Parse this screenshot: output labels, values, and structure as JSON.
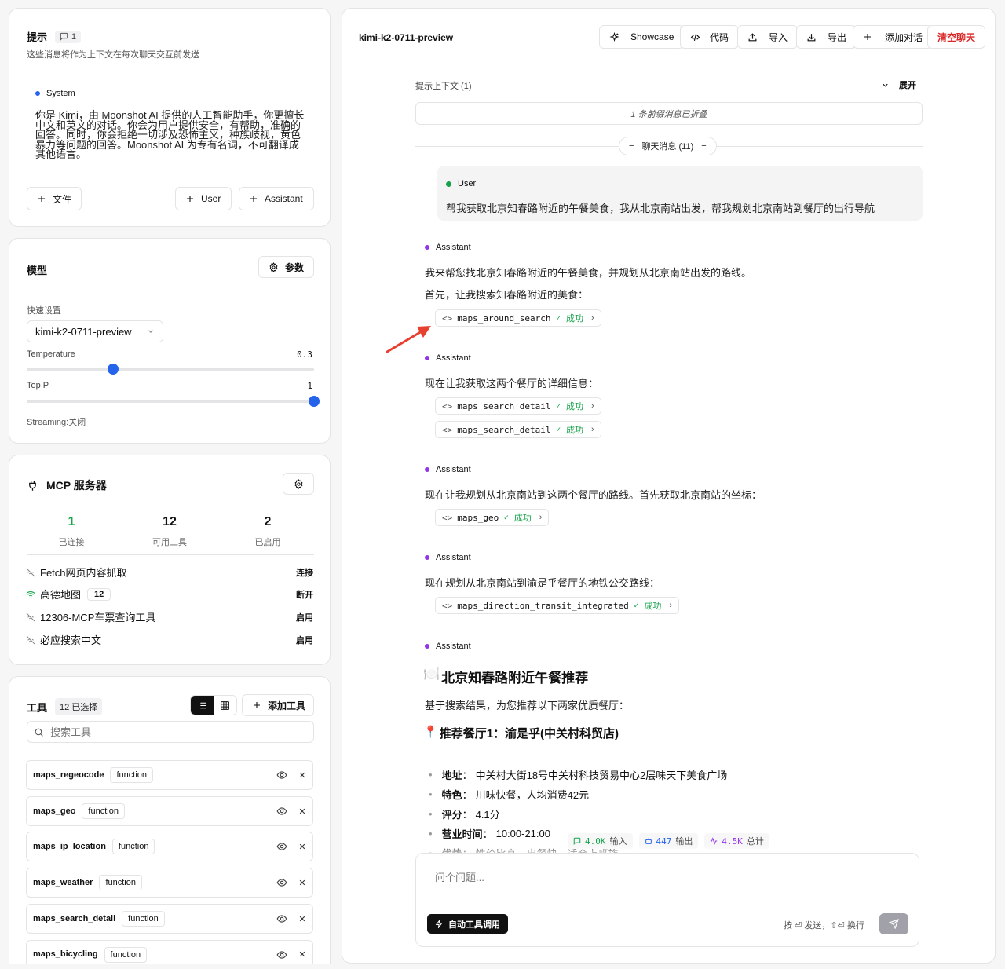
{
  "prompt": {
    "title": "提示",
    "count_badge": "1",
    "subtitle": "这些消息将作为上下文在每次聊天交互前发送",
    "system_role": "System",
    "system_text": "你是 Kimi，由 Moonshot AI 提供的人工智能助手，你更擅长中文和英文的对话。你会为用户提供安全，有帮助，准确的回答。同时，你会拒绝一切涉及恐怖主义，种族歧视，黄色暴力等问题的回答。Moonshot AI 为专有名词，不可翻译成其他语言。",
    "file_btn": "文件",
    "user_btn": "User",
    "assistant_btn": "Assistant"
  },
  "model": {
    "title": "模型",
    "params_btn": "参数",
    "quick_label": "快速设置",
    "model_value": "kimi-k2-0711-preview",
    "temperature_label": "Temperature",
    "temperature_value": "0.3",
    "temperature_fraction": 0.3,
    "topp_label": "Top P",
    "topp_value": "1",
    "topp_fraction": 1.0,
    "streaming": "Streaming:关闭"
  },
  "mcp": {
    "title": "MCP 服务器",
    "stats": [
      {
        "value": "1",
        "label": "已连接"
      },
      {
        "value": "12",
        "label": "可用工具"
      },
      {
        "value": "2",
        "label": "已启用"
      }
    ],
    "servers": [
      {
        "name": "Fetch网页内容抓取",
        "action": "连接",
        "badge": ""
      },
      {
        "name": "高德地图",
        "action": "断开",
        "badge": "12"
      },
      {
        "name": "12306-MCP车票查询工具",
        "action": "启用",
        "badge": ""
      },
      {
        "name": "必应搜索中文",
        "action": "启用",
        "badge": ""
      }
    ]
  },
  "tools": {
    "title": "工具",
    "selected_badge": "12 已选择",
    "add_btn": "添加工具",
    "search_placeholder": "搜索工具",
    "items": [
      {
        "name": "maps_regeocode",
        "type": "function"
      },
      {
        "name": "maps_geo",
        "type": "function"
      },
      {
        "name": "maps_ip_location",
        "type": "function"
      },
      {
        "name": "maps_weather",
        "type": "function"
      },
      {
        "name": "maps_search_detail",
        "type": "function"
      },
      {
        "name": "maps_bicycling",
        "type": "function"
      }
    ]
  },
  "chat": {
    "title": "kimi-k2-0711-preview",
    "toolbar": {
      "showcase": "Showcase",
      "code": "代码",
      "import": "导入",
      "export": "导出",
      "add_chat": "添加对话",
      "clear": "清空聊天"
    },
    "context_label": "提示上下文 (1)",
    "expand": "展开",
    "collapsed_note": "1 条前缀消息已折叠",
    "messages_pill": "聊天消息 (11)",
    "user_role": "User",
    "user_text": "帮我获取北京知春路附近的午餐美食，我从北京南站出发，帮我规划北京南站到餐厅的出行导航",
    "assistant_role": "Assistant",
    "success": "成功",
    "a1_line1": "我来帮您找北京知春路附近的午餐美食，并规划从北京南站出发的路线。",
    "a1_line2": "首先，让我搜索知春路附近的美食：",
    "a1_tool": "maps_around_search",
    "a2_line": "现在让我获取这两个餐厅的详细信息：",
    "a2_tool1": "maps_search_detail",
    "a2_tool2": "maps_search_detail",
    "a3_line": "现在让我规划从北京南站到这两个餐厅的路线。首先获取北京南站的坐标：",
    "a3_tool": "maps_geo",
    "a4_line": "现在规划从北京南站到渝是乎餐厅的地铁公交路线：",
    "a4_tool": "maps_direction_transit_integrated",
    "a5_heading_emoji": "🍽️",
    "a5_heading": "北京知春路附近午餐推荐",
    "a5_intro": "基于搜索结果，为您推荐以下两家优质餐厅：",
    "a5_sub_emoji": "📍",
    "a5_sub": "推荐餐厅1：渝是乎(中关村科贸店)",
    "details": [
      {
        "k": "地址",
        "v": "中关村大街18号中关村科技贸易中心2层味天下美食广场"
      },
      {
        "k": "特色",
        "v": "川味快餐，人均消费42元"
      },
      {
        "k": "评分",
        "v": "4.1分"
      },
      {
        "k": "营业时间",
        "v": "10:00-21:00"
      },
      {
        "k": "优势",
        "v": "性价比高，出餐快，适合上班族"
      }
    ],
    "tokens": {
      "input_value": "4.0K",
      "input_label": "输入",
      "output_value": "447",
      "output_label": "输出",
      "total_value": "4.5K",
      "total_label": "总计"
    },
    "input_placeholder": "问个问题...",
    "auto_tool_btn": "自动工具调用",
    "send_hint": "按 ⏎ 发送，⇧⏎ 换行"
  },
  "colors": {
    "accent_blue": "#2563eb",
    "success_green": "#16a34a",
    "assistant_purple": "#9333ea",
    "danger_red": "#dc2626"
  }
}
